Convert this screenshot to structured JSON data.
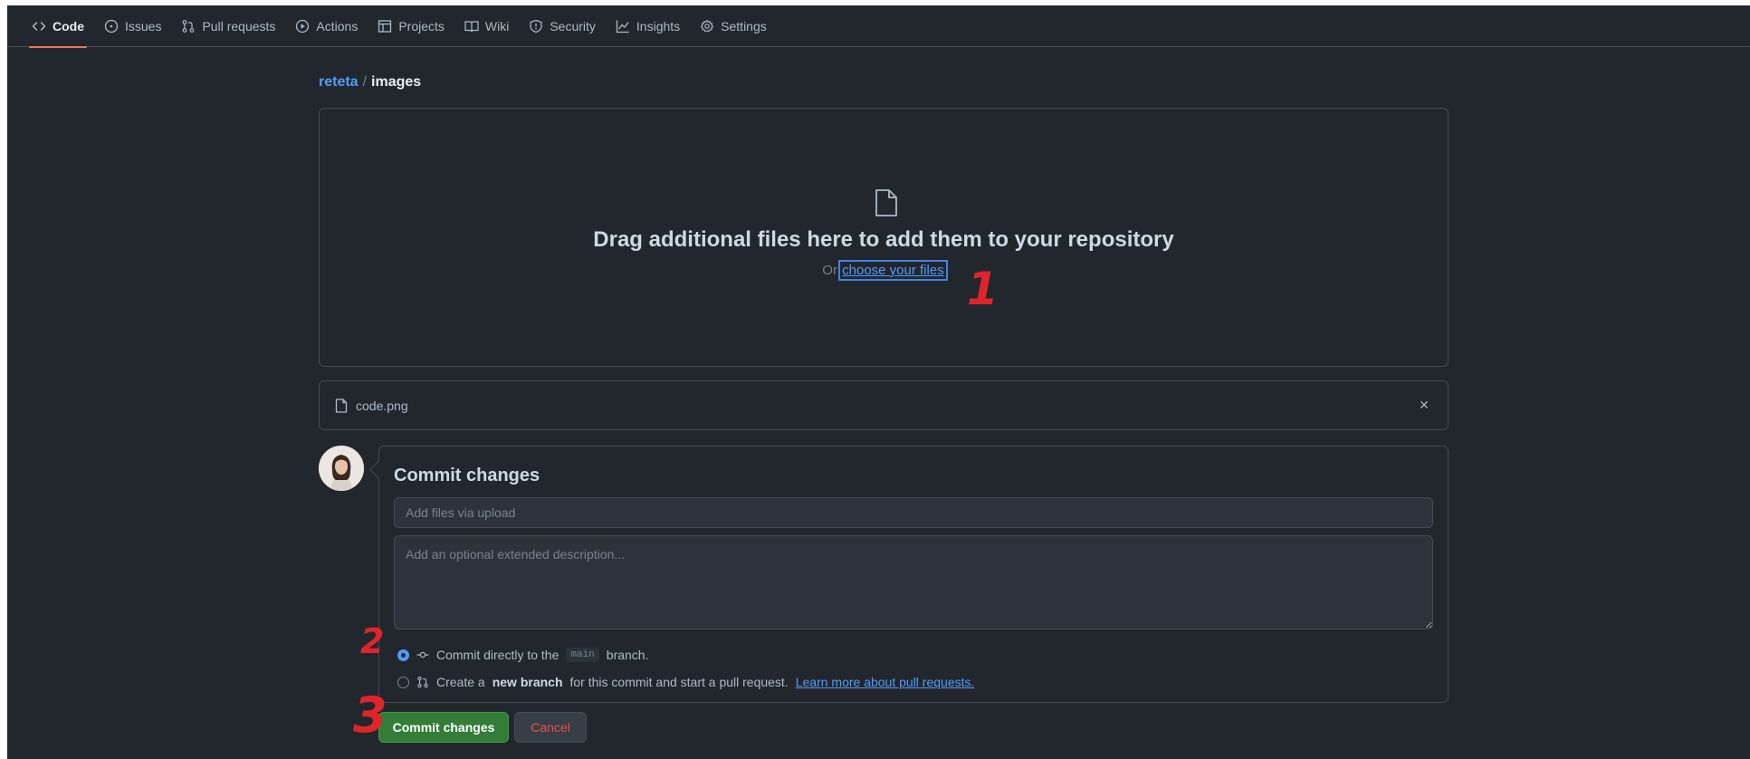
{
  "nav": {
    "items": [
      {
        "label": "Code",
        "icon": "code-icon",
        "active": true
      },
      {
        "label": "Issues",
        "icon": "issue-icon",
        "active": false
      },
      {
        "label": "Pull requests",
        "icon": "pull-request-icon",
        "active": false
      },
      {
        "label": "Actions",
        "icon": "play-icon",
        "active": false
      },
      {
        "label": "Projects",
        "icon": "table-icon",
        "active": false
      },
      {
        "label": "Wiki",
        "icon": "book-icon",
        "active": false
      },
      {
        "label": "Security",
        "icon": "shield-icon",
        "active": false
      },
      {
        "label": "Insights",
        "icon": "graph-icon",
        "active": false
      },
      {
        "label": "Settings",
        "icon": "gear-icon",
        "active": false
      }
    ]
  },
  "breadcrumb": {
    "repo": "reteta",
    "separator": "/",
    "folder": "images"
  },
  "dropzone": {
    "title": "Drag additional files here to add them to your repository",
    "prefix": "Or",
    "link": "choose your files"
  },
  "files": [
    {
      "name": "code.png"
    }
  ],
  "file_remove": "×",
  "commit": {
    "title": "Commit changes",
    "summary_placeholder": "Add files via upload",
    "description_placeholder": "Add an optional extended description...",
    "option_direct": {
      "before": "Commit directly to the",
      "branch": "main",
      "after": "branch."
    },
    "option_new_branch": {
      "before": "Create a",
      "bold": "new branch",
      "after": "for this commit and start a pull request.",
      "link": "Learn more about pull requests."
    },
    "submit_label": "Commit changes",
    "cancel_label": "Cancel"
  },
  "annotations": {
    "step1": "1",
    "step2": "2",
    "step3": "3"
  },
  "colors": {
    "background": "#22272e",
    "border": "#444c56",
    "accent_link": "#539bf5",
    "primary_button": "#347d39",
    "danger_text": "#e5534b",
    "annotation": "#e0242b",
    "active_tab_underline": "#ec775c"
  }
}
